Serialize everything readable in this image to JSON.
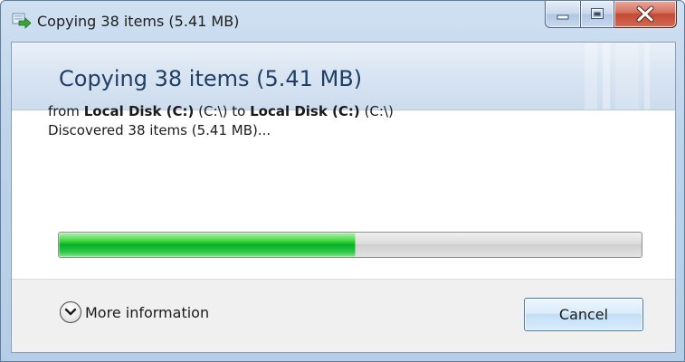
{
  "window": {
    "title": "Copying 38 items (5.41 MB)",
    "title_icon": "copy-arrow-icon"
  },
  "caption_buttons": {
    "minimize_icon": "minimize-icon",
    "maximize_icon": "maximize-icon",
    "close_icon": "close-icon"
  },
  "header": {
    "title": "Copying 38 items (5.41 MB)"
  },
  "transfer": {
    "from_prefix": "from",
    "source_name": "Local Disk (C:)",
    "source_path": "(C:\\)",
    "to_word": "to",
    "destination_name": "Local Disk (C:)",
    "destination_path": "(C:\\)",
    "status_text": "Discovered 38 items (5.41 MB)..."
  },
  "progress": {
    "fraction": 0.51
  },
  "footer": {
    "more_info_label": "More information",
    "more_info_icon": "chevron-down-circle-icon",
    "cancel_label": "Cancel"
  },
  "colors": {
    "progress_fill": "#06b025",
    "header_title": "#1f3f64",
    "close_button": "#c24a35"
  }
}
